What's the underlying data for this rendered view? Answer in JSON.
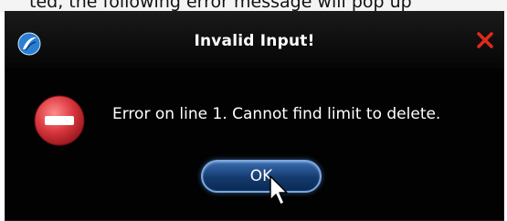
{
  "background": {
    "partial_text": "ted, the following error message will pop up"
  },
  "dialog": {
    "title": "Invalid Input!",
    "message": "Error on line 1. Cannot find limit to delete.",
    "ok_label": "OK",
    "icons": {
      "app": "app-logo-icon",
      "close": "close-icon",
      "error": "error-icon",
      "cursor": "mouse-pointer-icon"
    }
  },
  "colors": {
    "dialog_bg": "#000000",
    "close_red": "#e02a1c",
    "error_red": "#d8363d",
    "button_blue": "#143a6e"
  }
}
